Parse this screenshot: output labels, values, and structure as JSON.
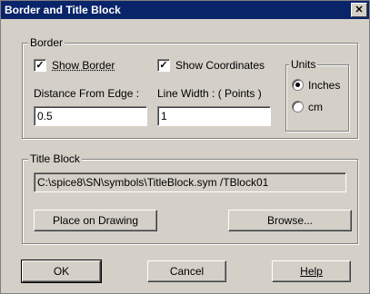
{
  "window": {
    "title": "Border and Title Block",
    "close_glyph": "✕"
  },
  "border_group": {
    "label": "Border",
    "show_border": {
      "label": "Show Border",
      "checked": true
    },
    "show_coordinates": {
      "label": "Show Coordinates",
      "checked": true
    },
    "distance_label": "Distance From  Edge :",
    "distance_value": "0.5",
    "line_width_label": "Line Width : ( Points )",
    "line_width_value": "1",
    "units": {
      "label": "Units",
      "inches_label": "Inches",
      "cm_label": "cm",
      "selected": "Inches"
    }
  },
  "title_block": {
    "label": "Title Block",
    "path": "C:\\spice8\\SN\\symbols\\TitleBlock.sym /TBlock01",
    "place_button": "Place on Drawing",
    "browse_button": "Browse..."
  },
  "footer": {
    "ok": "OK",
    "cancel": "Cancel",
    "help": "Help"
  }
}
